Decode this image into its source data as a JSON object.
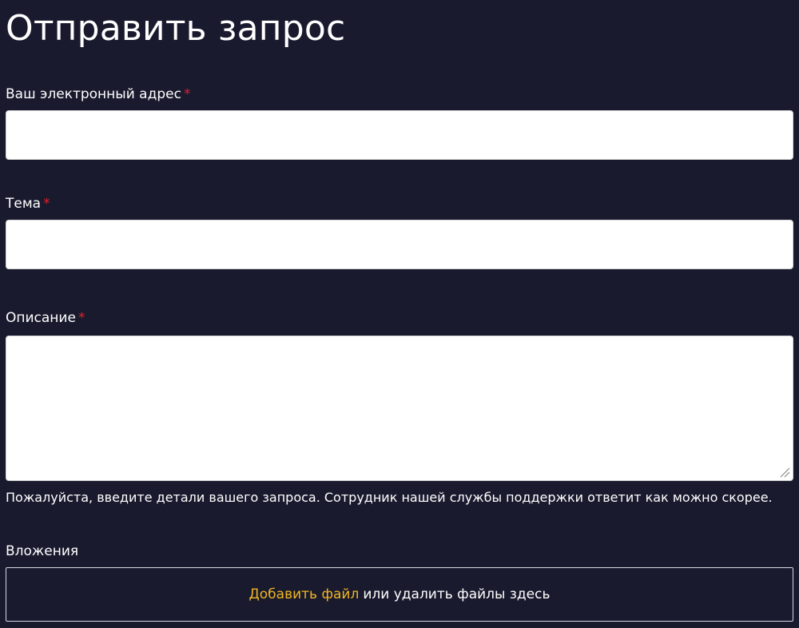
{
  "form": {
    "title": "Отправить запрос",
    "required_mark": "*",
    "email": {
      "label": "Ваш электронный адрес",
      "value": "",
      "placeholder": ""
    },
    "subject": {
      "label": "Тема",
      "value": "",
      "placeholder": ""
    },
    "description": {
      "label": "Описание",
      "value": "",
      "placeholder": "",
      "hint": "Пожалуйста, введите детали вашего запроса. Сотрудник нашей службы поддержки ответит как можно скорее."
    },
    "attachments": {
      "label": "Вложения",
      "add_file_link": "Добавить файл",
      "drop_text": "или удалить файлы здесь"
    }
  },
  "colors": {
    "background": "#191a2e",
    "link": "#f1b621",
    "required": "#e0202a",
    "input_background": "#ffffff"
  },
  "icons": {
    "resize": "textarea-resize-grip-icon"
  }
}
